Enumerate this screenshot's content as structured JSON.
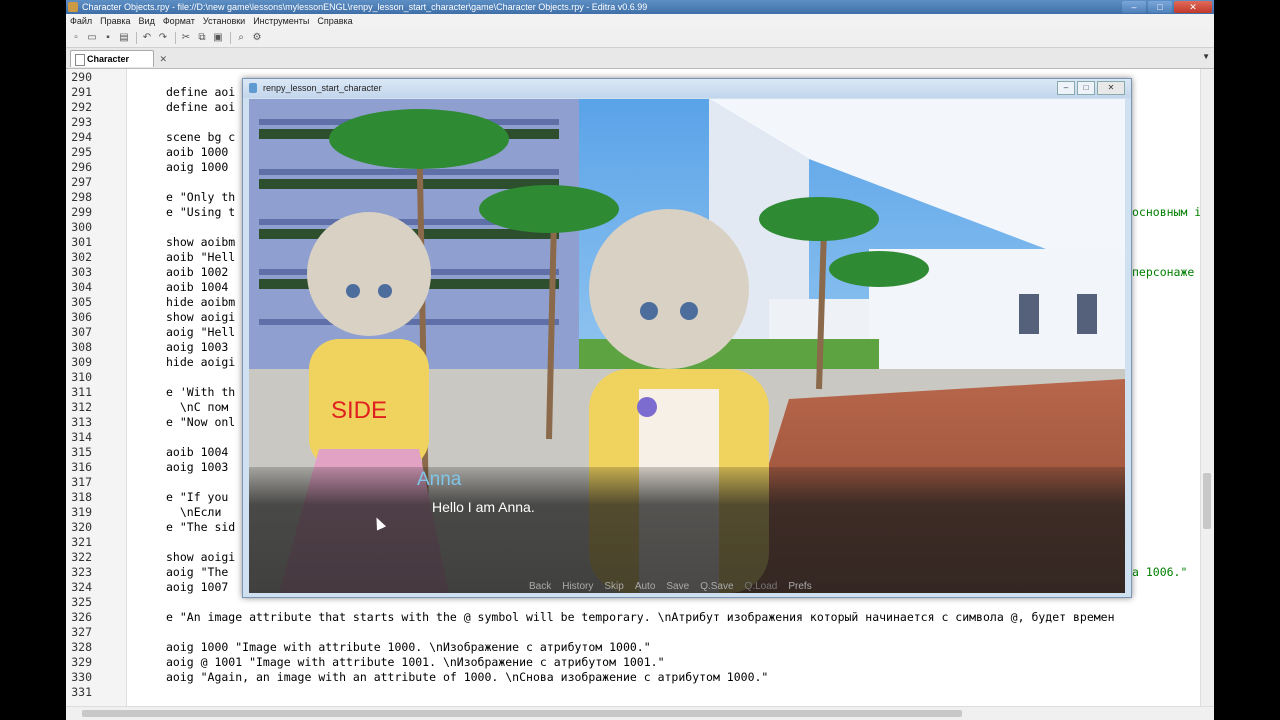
{
  "editor": {
    "title": "Character Objects.rpy - file://D:\\new game\\lessons\\mylessonENGL\\renpy_lesson_start_character\\game\\Character Objects.rpy - Editra v0.6.99",
    "menu": [
      "Файл",
      "Правка",
      "Вид",
      "Формат",
      "Установки",
      "Инструменты",
      "Справка"
    ],
    "tab_label": "Character Obj...",
    "lines": [
      {
        "n": "290",
        "code": ""
      },
      {
        "n": "291",
        "code": "define aoi"
      },
      {
        "n": "292",
        "code": "define aoi"
      },
      {
        "n": "293",
        "code": ""
      },
      {
        "n": "294",
        "code": "scene bg c"
      },
      {
        "n": "295",
        "code": "aoib 1000"
      },
      {
        "n": "296",
        "code": "aoig 1000"
      },
      {
        "n": "297",
        "code": ""
      },
      {
        "n": "298",
        "code": "e \"Only th"
      },
      {
        "n": "299",
        "code": "e \"Using t"
      },
      {
        "n": "300",
        "code": ""
      },
      {
        "n": "301",
        "code": "show aoibm"
      },
      {
        "n": "302",
        "code": "aoib \"Hell"
      },
      {
        "n": "303",
        "code": "aoib 1002"
      },
      {
        "n": "304",
        "code": "aoib 1004"
      },
      {
        "n": "305",
        "code": "hide aoibm"
      },
      {
        "n": "306",
        "code": "show aoigi"
      },
      {
        "n": "307",
        "code": "aoig \"Hell"
      },
      {
        "n": "308",
        "code": "aoig 1003"
      },
      {
        "n": "309",
        "code": "hide aoigi"
      },
      {
        "n": "310",
        "code": ""
      },
      {
        "n": "311",
        "code": "e 'With th"
      },
      {
        "n": "312",
        "code": "  \\nC пом"
      },
      {
        "n": "313",
        "code": "e \"Now onl"
      },
      {
        "n": "314",
        "code": ""
      },
      {
        "n": "315",
        "code": "aoib 1004"
      },
      {
        "n": "316",
        "code": "aoig 1003"
      },
      {
        "n": "317",
        "code": ""
      },
      {
        "n": "318",
        "code": "e \"If you"
      },
      {
        "n": "319",
        "code": "  \\nЕсли"
      },
      {
        "n": "320",
        "code": "e \"The sid"
      },
      {
        "n": "321",
        "code": ""
      },
      {
        "n": "322",
        "code": "show aoigi"
      },
      {
        "n": "323",
        "code": "aoig \"The"
      },
      {
        "n": "324",
        "code": "aoig 1007"
      },
      {
        "n": "325",
        "code": ""
      },
      {
        "n": "326",
        "code": "e \"An image attribute that starts with the @ symbol will be temporary. \\nАтрибут изображения который начинается с символа @, будет времен"
      },
      {
        "n": "327",
        "code": ""
      },
      {
        "n": "328",
        "code": "aoig 1000 \"Image with attribute 1000. \\nИзображение с атрибутом 1000.\""
      },
      {
        "n": "329",
        "code": "aoig @ 1001 \"Image with attribute 1001. \\nИзображение с атрибутом 1001.\""
      },
      {
        "n": "330",
        "code": "aoig \"Again, an image with an attribute of 1000. \\nСнова изображение с атрибутом 1000.\""
      },
      {
        "n": "331",
        "code": ""
      }
    ],
    "right_fragments": [
      {
        "line": "299",
        "text": "основным i"
      },
      {
        "line": "303",
        "text": "персонаже"
      },
      {
        "line": "323",
        "text": "а 1006.\""
      }
    ]
  },
  "game": {
    "title": "renpy_lesson_start_character",
    "side_label": "SIDE",
    "speaker": "Anna",
    "dialogue": "Hello I am Anna.",
    "quick_menu": [
      "Back",
      "History",
      "Skip",
      "Auto",
      "Save",
      "Q.Save",
      "Q.Load",
      "Prefs"
    ]
  },
  "colors": {
    "titlebar": "#3e6fa8",
    "speaker": "#7fc6e8",
    "side": "#e02020",
    "keyword": "#00007f",
    "string": "#007f00"
  }
}
